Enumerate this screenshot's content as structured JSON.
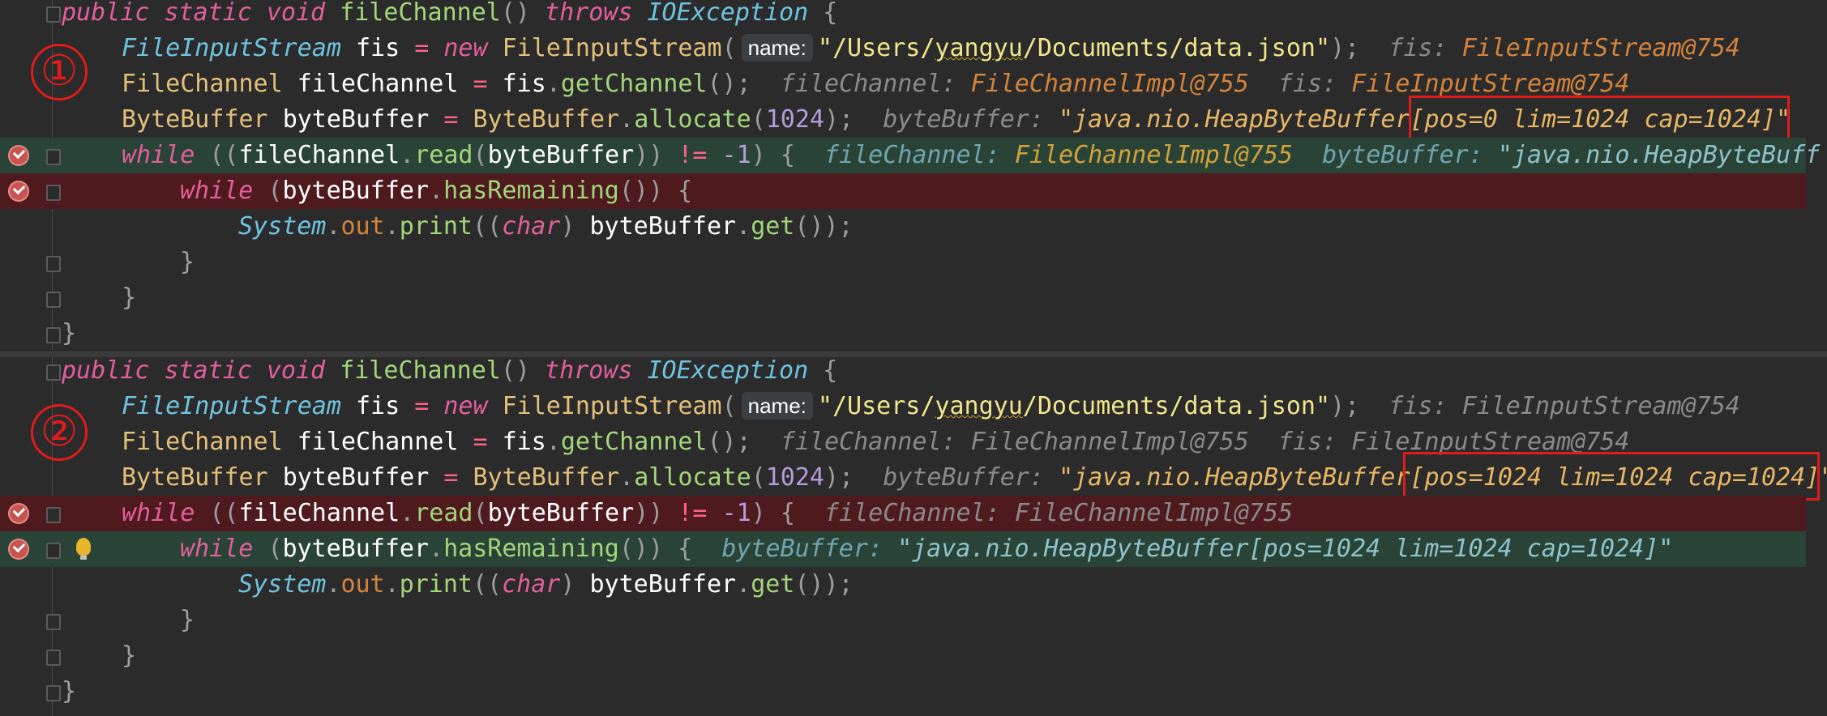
{
  "common": {
    "sig_kw1": "public",
    "sig_kw2": "static",
    "sig_kw3": "void",
    "method_name": "fileChannel",
    "sig_parens": "()",
    "throws": "throws",
    "exception": "IOException",
    "open_brace": "{",
    "close_brace": "}",
    "type_fis": "FileInputStream",
    "var_fis": "fis",
    "eq": "=",
    "kw_new": "new",
    "ctor_fis": "FileInputStream",
    "paren_open": "(",
    "param_hint": "name:",
    "path_string": "\"/Users/",
    "path_user": "yangyu",
    "path_rest": "/Documents/data.json\"",
    "paren_close_semi": ");",
    "type_fc": "FileChannel",
    "var_fc": "fileChannel",
    "get_channel": "getChannel",
    "call_end": "();",
    "type_bb": "ByteBuffer",
    "var_bb": "byteBuffer",
    "cls_bb": "ByteBuffer",
    "allocate": "allocate",
    "size": "1024",
    "kw_while": "while",
    "read": "read",
    "neq": "!=",
    "minus_one": "-1",
    "has_remaining": "hasRemaining",
    "system": "System",
    "out": "out",
    "print": "print",
    "kw_char": "char",
    "get": "get",
    "fis_hint_label": "fis:",
    "fis_hint_value": "FileInputStream@754",
    "fc_hint_label": "fileChannel:",
    "fc_hint_value": "FileChannelImpl@755",
    "bb_hint_label": "byteBuffer:",
    "bb_hint_prefix": "\"java.nio.HeapByteBuffer",
    "quote": "\""
  },
  "panel1": {
    "step_label": "①",
    "bb_state": "[pos=0 lim=1024 cap=1024]",
    "outer_while_tail": "\"java.nio.HeapByteBuff"
  },
  "panel2": {
    "step_label": "②",
    "bb_state": "[pos=1024 lim=1024 cap=1024]",
    "inner_while_hint": "\"java.nio.HeapByteBuffer[pos=1024 lim=1024 cap=1024]\""
  },
  "colors": {
    "background": "#2b2b2b",
    "current_line": "#294436",
    "breakpoint_line": "#4f1a1d",
    "annotation_red": "#e01b1b"
  },
  "icons": [
    "breakpoint-icon",
    "fold-marker-icon",
    "lightbulb-icon"
  ]
}
